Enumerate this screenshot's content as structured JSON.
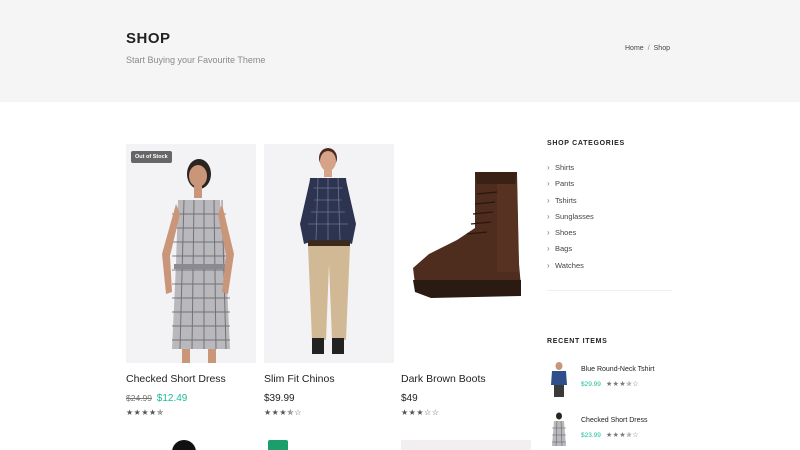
{
  "header": {
    "title": "SHOP",
    "subtitle": "Start Buying your Favourite Theme",
    "breadcrumb": {
      "home": "Home",
      "separator": "/",
      "current": "Shop"
    }
  },
  "products": [
    {
      "name": "Checked Short Dress",
      "old_price": "$24.99",
      "price": "$12.49",
      "rating": 4.5,
      "stars": "★★★★✯",
      "badge": "Out of Stock"
    },
    {
      "name": "Slim Fit Chinos",
      "price": "$39.99",
      "rating": 3.5,
      "stars": "★★★✯☆"
    },
    {
      "name": "Dark Brown Boots",
      "price": "$49",
      "rating": 3,
      "stars": "★★★☆☆"
    }
  ],
  "sidebar": {
    "categories_title": "SHOP CATEGORIES",
    "categories": [
      "Shirts",
      "Pants",
      "Tshirts",
      "Sunglasses",
      "Shoes",
      "Bags",
      "Watches"
    ],
    "recent_title": "RECENT ITEMS",
    "recent_items": [
      {
        "name": "Blue Round-Neck Tshirt",
        "price": "$29.99",
        "rating": 3.5,
        "stars": "★★★✯☆"
      },
      {
        "name": "Checked Short Dress",
        "price": "$23.99",
        "rating": 3,
        "stars": "★★★✯☆"
      }
    ]
  },
  "colors": {
    "accent": "#1abc9c",
    "header_bg": "#f5f5f5",
    "badge_bg": "#666666"
  },
  "icons": {
    "category_bullet": "chevron-right-icon",
    "rating": "star-icon"
  }
}
